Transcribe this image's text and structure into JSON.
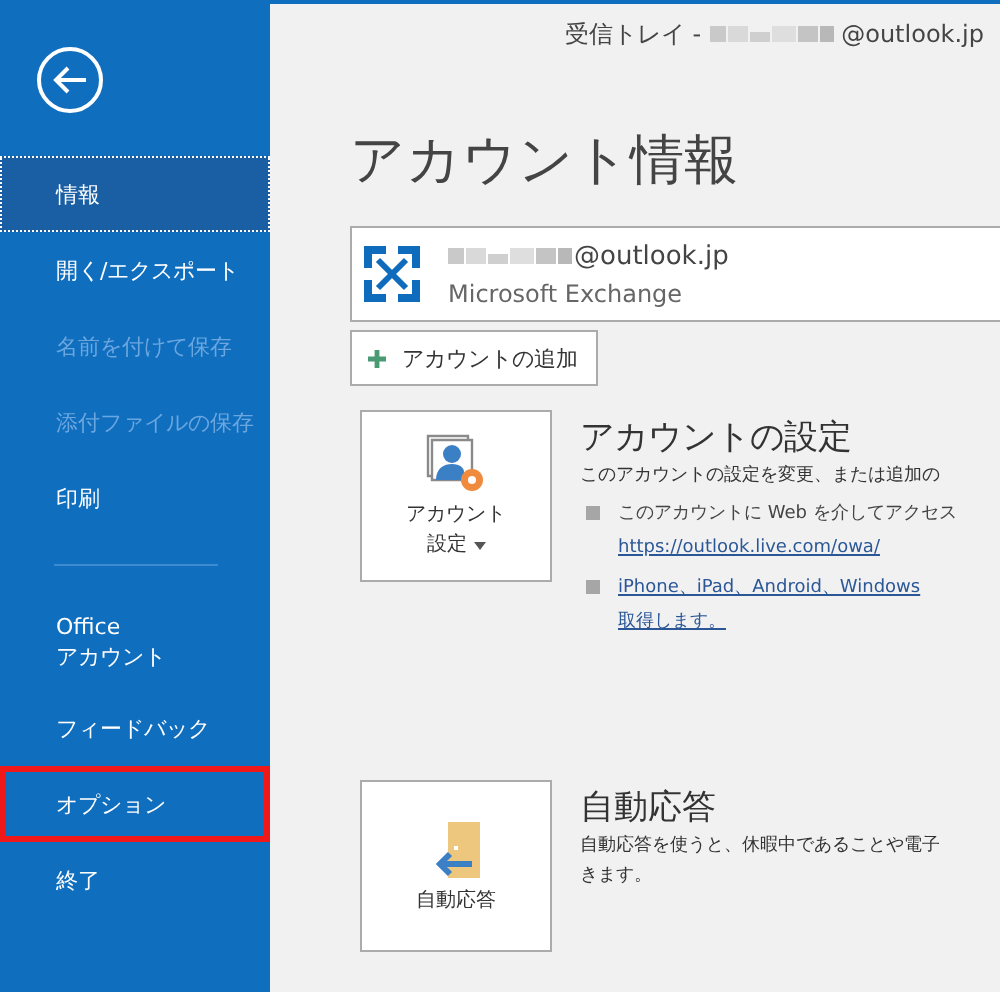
{
  "sidebar": {
    "items": [
      {
        "kind": "item",
        "label": "情報",
        "selected": true,
        "disabled": false,
        "highlighted": false
      },
      {
        "kind": "item",
        "label": "開く/エクスポート",
        "selected": false,
        "disabled": false,
        "highlighted": false
      },
      {
        "kind": "item",
        "label": "名前を付けて保存",
        "selected": false,
        "disabled": true,
        "highlighted": false
      },
      {
        "kind": "item",
        "label": "添付ファイルの保存",
        "selected": false,
        "disabled": true,
        "highlighted": false
      },
      {
        "kind": "item",
        "label": "印刷",
        "selected": false,
        "disabled": false,
        "highlighted": false
      },
      {
        "kind": "divider"
      },
      {
        "kind": "item",
        "label": "Office\nアカウント",
        "selected": false,
        "disabled": false,
        "highlighted": false
      },
      {
        "kind": "item",
        "label": "フィードバック",
        "selected": false,
        "disabled": false,
        "highlighted": false
      },
      {
        "kind": "item",
        "label": "オプション",
        "selected": false,
        "disabled": false,
        "highlighted": true
      },
      {
        "kind": "item",
        "label": "終了",
        "selected": false,
        "disabled": false,
        "highlighted": false
      }
    ]
  },
  "header": {
    "prefix": "受信トレイ -",
    "email_suffix": "@outlook.jp"
  },
  "page_title": "アカウント情報",
  "account": {
    "email_suffix": "@outlook.jp",
    "type": "Microsoft Exchange"
  },
  "add_account_button": {
    "label": "アカウントの追加"
  },
  "sections": [
    {
      "kind": "settings",
      "tile_lines": [
        "アカウント",
        "設定"
      ],
      "dropdown": true,
      "title": "アカウントの設定",
      "description": [
        "このアカウントの設定を変更、または追加の"
      ],
      "bullets": [
        [
          {
            "text": "このアカウントに Web を介してアクセス",
            "link": false
          },
          {
            "text": "https://outlook.live.com/owa/",
            "link": true
          }
        ],
        [
          {
            "text": "iPhone、iPad、Android、Windows",
            "link": true
          },
          {
            "text": "取得します。",
            "link": true
          }
        ]
      ]
    },
    {
      "kind": "auto_reply",
      "tile_lines": [
        "自動応答"
      ],
      "title": "自動応答",
      "description": [
        "自動応答を使うと、休暇中であることや電子",
        "きます。"
      ]
    }
  ]
}
